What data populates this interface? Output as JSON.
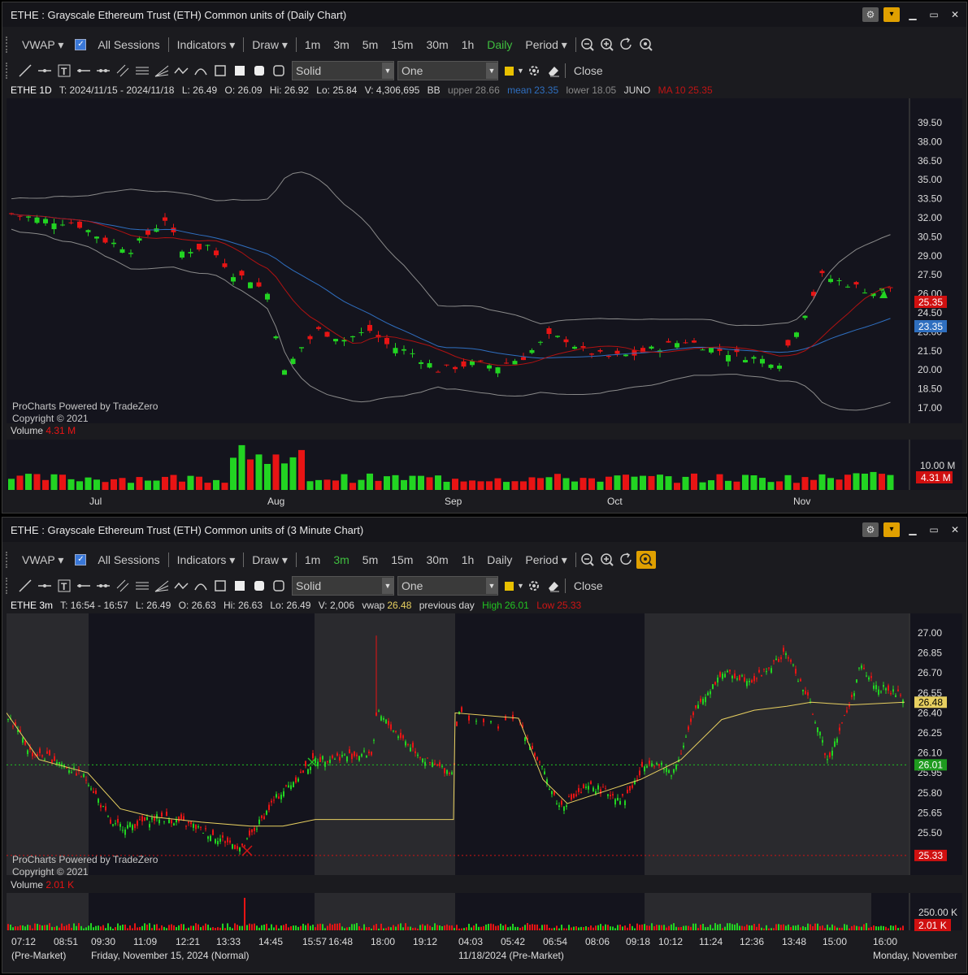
{
  "top": {
    "title": "ETHE : Grayscale Ethereum Trust (ETH) Common units of (Daily Chart)",
    "toolbar": {
      "vwap": "VWAP",
      "all_sessions": "All Sessions",
      "indicators": "Indicators",
      "draw": "Draw",
      "timeframes": [
        "1m",
        "3m",
        "5m",
        "15m",
        "30m",
        "1h",
        "Daily"
      ],
      "selected_timeframe": "Daily",
      "period": "Period"
    },
    "style_select": "Solid",
    "width_select": "One",
    "close_label": "Close",
    "info": {
      "symbol": "ETHE 1D",
      "t": "T: 2024/11/15 - 2024/11/18",
      "l": "L: 26.49",
      "o": "O: 26.09",
      "hi": "Hi: 26.92",
      "lo": "Lo: 25.84",
      "v": "V: 4,306,695",
      "bb": "BB",
      "upper_label": "upper",
      "upper_val": "28.66",
      "mean_label": "mean",
      "mean_val": "23.35",
      "lower_label": "lower",
      "lower_val": "18.05",
      "juno": "JUNO",
      "ma_label": "MA 10",
      "ma_val": "25.35"
    },
    "credit1": "ProCharts Powered by TradeZero",
    "credit2": "Copyright © 2021",
    "volume_label": "Volume",
    "volume_val": "4.31 M",
    "price_ticks": [
      "39.50",
      "38.00",
      "36.50",
      "35.00",
      "33.50",
      "32.00",
      "30.50",
      "29.00",
      "27.50",
      "26.00",
      "24.50",
      "23.00",
      "21.50",
      "20.00",
      "18.50",
      "17.00"
    ],
    "tag_ma": "25.35",
    "tag_mean": "23.35",
    "vol_tick": "10.00 M",
    "vol_tag": "4.31 M",
    "x_labels": [
      "Jul",
      "Aug",
      "Sep",
      "Oct",
      "Nov"
    ],
    "colors": {
      "up": "#22d422",
      "down": "#e81414",
      "bb": "#9a9a9a",
      "mean": "#2f6fc0",
      "ma": "#c01414"
    }
  },
  "bottom": {
    "title": "ETHE : Grayscale Ethereum Trust (ETH) Common units of (3 Minute Chart)",
    "toolbar": {
      "vwap": "VWAP",
      "all_sessions": "All Sessions",
      "indicators": "Indicators",
      "draw": "Draw",
      "timeframes": [
        "1m",
        "3m",
        "5m",
        "15m",
        "30m",
        "1h",
        "Daily"
      ],
      "selected_timeframe": "3m",
      "period": "Period"
    },
    "style_select": "Solid",
    "width_select": "One",
    "close_label": "Close",
    "info": {
      "symbol": "ETHE 3m",
      "t": "T: 16:54 - 16:57",
      "l": "L: 26.49",
      "o": "O: 26.63",
      "hi": "Hi: 26.63",
      "lo": "Lo: 26.49",
      "v": "V: 2,006",
      "vwap_label": "vwap",
      "vwap_val": "26.48",
      "prev_day": "previous day",
      "high_label": "High",
      "high_val": "26.01",
      "low_label": "Low",
      "low_val": "25.33"
    },
    "credit1": "ProCharts Powered by TradeZero",
    "credit2": "Copyright © 2021",
    "volume_label": "Volume",
    "volume_val": "2.01 K",
    "price_ticks": [
      "27.00",
      "26.85",
      "26.70",
      "26.55",
      "26.40",
      "26.25",
      "26.10",
      "25.95",
      "25.80",
      "25.65",
      "25.50"
    ],
    "tag_vwap": "26.48",
    "tag_high": "26.01",
    "tag_low": "25.33",
    "vol_tick": "250.00 K",
    "vol_tag": "2.01 K",
    "time_labels": [
      "07:12",
      "08:51",
      "09:30",
      "11:09",
      "12:21",
      "13:33",
      "14:45",
      "15:57",
      "16:48",
      "18:00",
      "19:12",
      "04:03",
      "05:42",
      "06:54",
      "08:06",
      "09:18",
      "10:12",
      "11:24",
      "12:36",
      "13:48",
      "15:00",
      "16:00"
    ],
    "session_labels": [
      "(Pre-Market)",
      "Friday, November 15, 2024 (Normal)",
      "11/18/2024 (Pre-Market)",
      "Monday, November"
    ]
  }
}
